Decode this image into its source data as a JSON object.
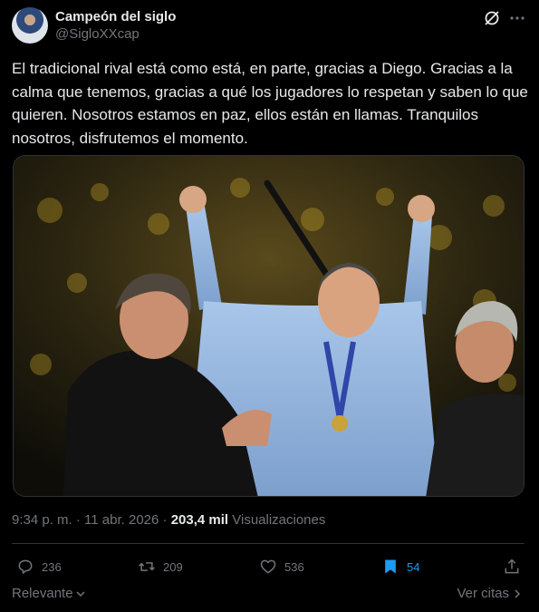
{
  "author": {
    "display_name": "Campeón del siglo",
    "handle": "@SigloXXcap"
  },
  "tweet": {
    "text": "El tradicional rival está como está, en parte, gracias a Diego. Gracias a la calma que tenemos, gracias a qué los jugadores lo respetan y saben lo que quieren. Nosotros estamos en paz, ellos están en llamas. Tranquilos nosotros, disfrutemos el momento."
  },
  "meta": {
    "time": "9:34 p. m.",
    "date": "11 abr. 2026",
    "separator": "·",
    "views_count": "203,4 mil",
    "views_label": "Visualizaciones"
  },
  "actions": {
    "replies": "236",
    "retweets": "209",
    "likes": "536",
    "bookmarks": "54"
  },
  "footer": {
    "sort_label": "Relevante",
    "quotes_label": "Ver citas"
  },
  "colors": {
    "background": "#000000",
    "text": "#e7e9ea",
    "muted": "#71767b",
    "accent": "#1d9bf0",
    "border": "#2f3336"
  },
  "icons": [
    "grok-icon",
    "more-icon",
    "reply-icon",
    "retweet-icon",
    "like-icon",
    "bookmark-icon",
    "share-icon",
    "chevron-down-icon",
    "chevron-right-icon"
  ]
}
